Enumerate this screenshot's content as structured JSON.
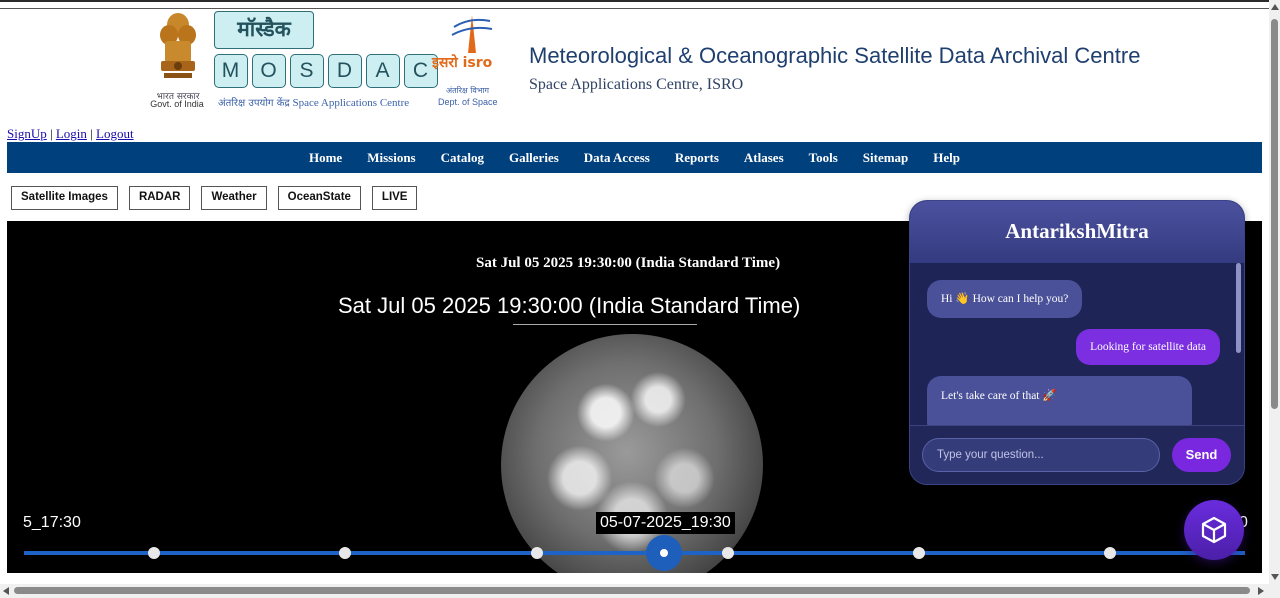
{
  "header": {
    "emblem_caption_hindi": "भारत सरकार",
    "emblem_caption": "Govt. of India",
    "logo_hindi": "मॉस्डैक",
    "logo_letters": [
      "M",
      "O",
      "S",
      "D",
      "A",
      "C"
    ],
    "sac_hindi": "अंतरिक्ष उपयोग केंद्र",
    "sac_english": "Space Applications Centre",
    "isro_logo_text": "इसरो isro",
    "isro_caption_hindi": "अंतरिक्ष विभाग",
    "isro_caption": "Dept. of Space",
    "title": "Meteorological & Oceanographic Satellite Data Archival Centre",
    "subtitle": "Space Applications Centre, ISRO"
  },
  "auth": {
    "signup": "SignUp",
    "sep": "|",
    "login": "Login",
    "logout": "Logout"
  },
  "nav": [
    "Home",
    "Missions",
    "Catalog",
    "Galleries",
    "Data Access",
    "Reports",
    "Atlases",
    "Tools",
    "Sitemap",
    "Help"
  ],
  "subnav": [
    "Satellite Images",
    "RADAR",
    "Weather",
    "OceanState",
    "LIVE"
  ],
  "viewer": {
    "timestamp_small": "Sat Jul 05 2025 19:30:00 (India Standard Time)",
    "timestamp_large": "Sat Jul 05 2025 19:30:00 (India Standard Time)",
    "frame_left_label": "5_17:30",
    "frame_active_label": "05-07-2025_19:30",
    "frame_right_label": "0"
  },
  "chat": {
    "title": "AntarikshMitra",
    "messages": [
      {
        "role": "bot",
        "text": "Hi 👋 How can I help you?"
      },
      {
        "role": "user",
        "text": "Looking for satellite data"
      },
      {
        "role": "bot",
        "text": "Let's take care of that 🚀"
      }
    ],
    "input_placeholder": "Type your question...",
    "send_label": "Send"
  },
  "colors": {
    "nav_bg": "#00407d",
    "chat_accent": "#7a28df",
    "timeline": "#1e63c6"
  }
}
